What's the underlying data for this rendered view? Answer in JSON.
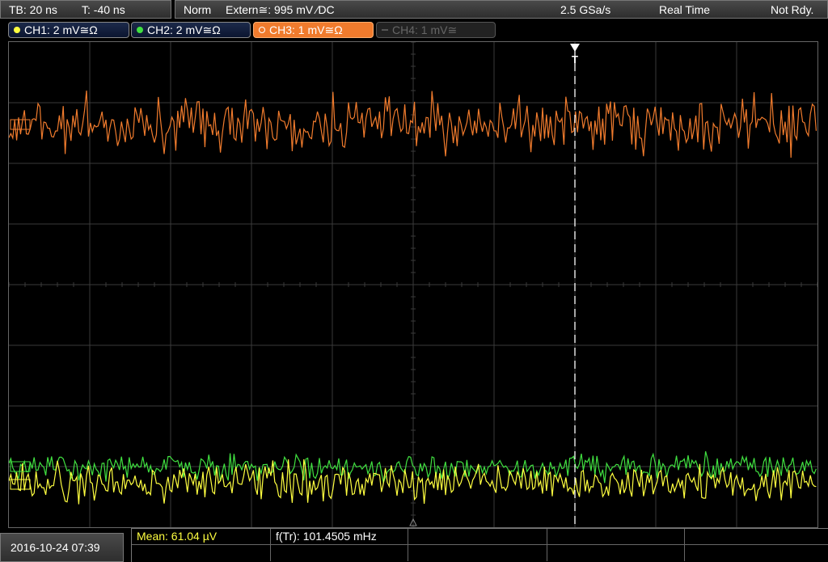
{
  "topbar": {
    "timebase": "TB: 20 ns",
    "trigger_time": "T: -40 ns",
    "trigger_mode": "Norm",
    "trigger_source": "Extern≅: 995 mV ∕DC",
    "sample_rate": "2.5 GSa/s",
    "acq_mode": "Real Time",
    "status": "Not Rdy."
  },
  "channels": [
    {
      "label": "CH1: 2 mV≅Ω",
      "color": "#ffff40",
      "state": "on"
    },
    {
      "label": "CH2: 2 mV≅Ω",
      "color": "#40e040",
      "state": "on"
    },
    {
      "label": "CH3: 1 mV≅Ω",
      "color": "#f07b2d",
      "state": "active"
    },
    {
      "label": "CH4: 1 mV≅",
      "color": "#666666",
      "state": "off"
    }
  ],
  "markers": {
    "trigger_marker": "T"
  },
  "status_bar": {
    "datetime": "2016-10-24 07:39",
    "measurement_1": "Mean: 61.04 µV",
    "measurement_2": "f(Tr): 101.4505 mHz"
  },
  "colors": {
    "ch1": "#ffff40",
    "ch2": "#40e040",
    "ch3": "#f07b2d",
    "grid": "#3a3a3a",
    "trigger_line": "#ffffff",
    "measurement_text": "#ffff40"
  }
}
